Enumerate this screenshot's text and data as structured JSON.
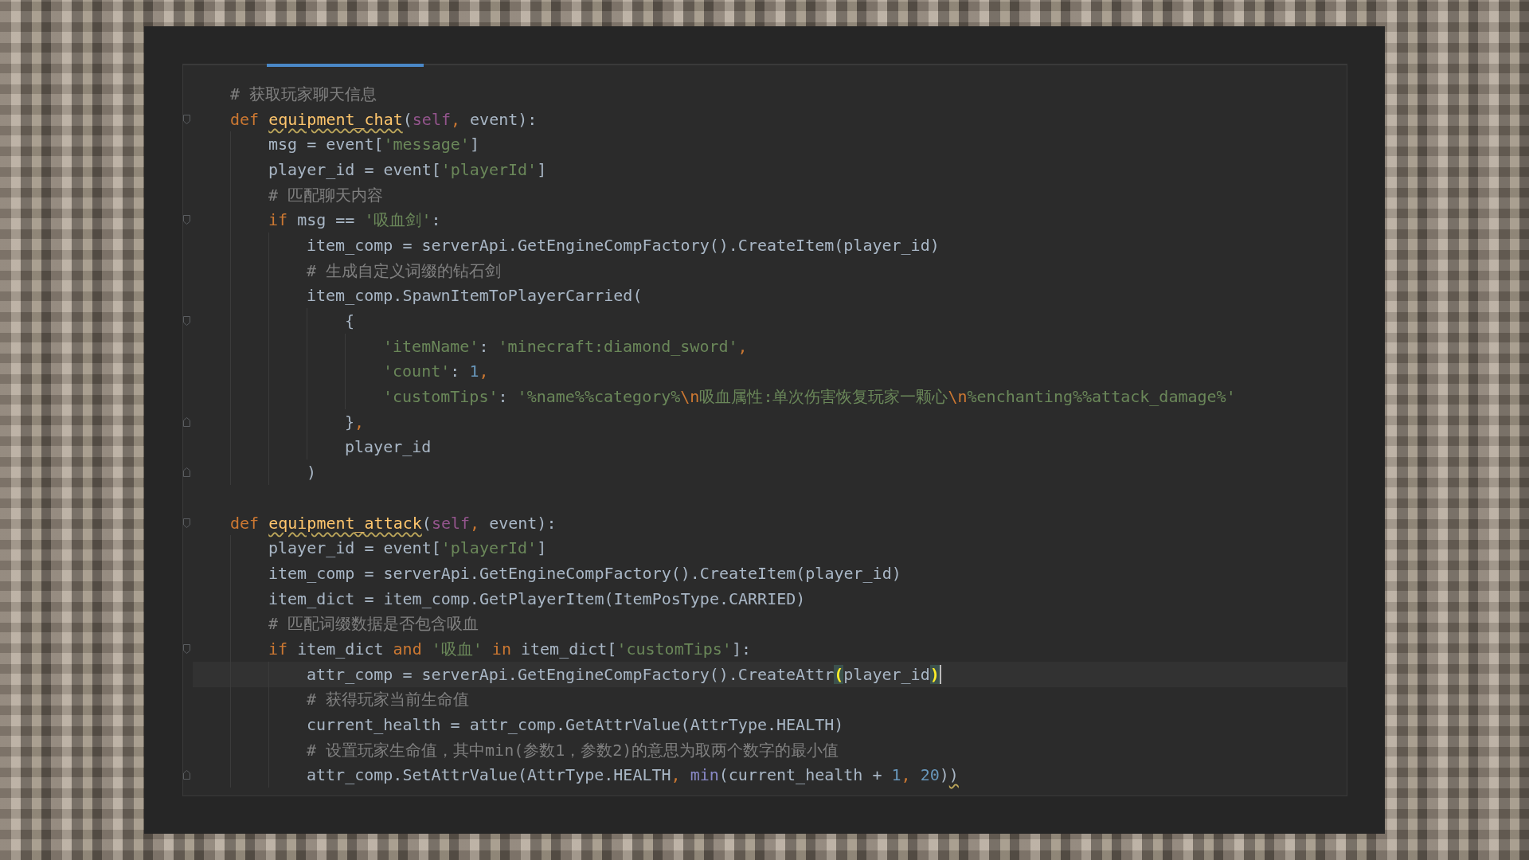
{
  "editor": {
    "lines": [
      {
        "kind": "code",
        "current": false,
        "caret": false,
        "tokens": [
          {
            "text": "# 获取玩家聊天信息",
            "kind": "comment"
          }
        ]
      },
      {
        "kind": "code",
        "fold_start": true,
        "current": false,
        "caret": false,
        "tokens": [
          {
            "text": "def ",
            "kind": "kw"
          },
          {
            "text": "equipment_chat",
            "kind": "fn_warned"
          },
          {
            "text": "(",
            "kind": "plain"
          },
          {
            "text": "self",
            "kind": "self"
          },
          {
            "text": ",",
            "kind": "punct"
          },
          {
            "text": " event):",
            "kind": "plain"
          }
        ],
        "children": [
          {
            "kind": "code",
            "current": false,
            "caret": false,
            "tokens": [
              {
                "text": "msg = event[",
                "kind": "plain"
              },
              {
                "text": "'message'",
                "kind": "str"
              },
              {
                "text": "]",
                "kind": "plain"
              }
            ]
          },
          {
            "kind": "code",
            "current": false,
            "caret": false,
            "tokens": [
              {
                "text": "player_id = event[",
                "kind": "plain"
              },
              {
                "text": "'playerId'",
                "kind": "str"
              },
              {
                "text": "]",
                "kind": "plain"
              }
            ]
          },
          {
            "kind": "code",
            "current": false,
            "caret": false,
            "tokens": [
              {
                "text": "# 匹配聊天内容",
                "kind": "comment"
              }
            ]
          },
          {
            "kind": "code",
            "fold_start": true,
            "current": false,
            "caret": false,
            "tokens": [
              {
                "text": "if",
                "kind": "kw"
              },
              {
                "text": " msg == ",
                "kind": "plain"
              },
              {
                "text": "'吸血剑'",
                "kind": "str"
              },
              {
                "text": ":",
                "kind": "plain"
              }
            ],
            "children": [
              {
                "kind": "code",
                "current": false,
                "caret": false,
                "tokens": [
                  {
                    "text": "item_comp = serverApi.GetEngineCompFactory().CreateItem(player_id)",
                    "kind": "plain"
                  }
                ]
              },
              {
                "kind": "code",
                "current": false,
                "caret": false,
                "tokens": [
                  {
                    "text": "# 生成自定义词缀的钻石剑",
                    "kind": "comment"
                  }
                ]
              },
              {
                "kind": "code",
                "current": false,
                "caret": false,
                "tokens": [
                  {
                    "text": "item_comp.SpawnItemToPlayerCarried(",
                    "kind": "plain"
                  }
                ],
                "children": [
                  {
                    "kind": "code",
                    "fold_start": true,
                    "current": false,
                    "caret": false,
                    "tokens": [
                      {
                        "text": "{",
                        "kind": "plain"
                      }
                    ],
                    "children": [
                      {
                        "kind": "code",
                        "current": false,
                        "caret": false,
                        "tokens": [
                          {
                            "text": "'itemName'",
                            "kind": "str"
                          },
                          {
                            "text": ": ",
                            "kind": "plain"
                          },
                          {
                            "text": "'minecraft:diamond_sword'",
                            "kind": "str"
                          },
                          {
                            "text": ",",
                            "kind": "punct"
                          }
                        ]
                      },
                      {
                        "kind": "code",
                        "current": false,
                        "caret": false,
                        "tokens": [
                          {
                            "text": "'count'",
                            "kind": "str"
                          },
                          {
                            "text": ": ",
                            "kind": "plain"
                          },
                          {
                            "text": "1",
                            "kind": "num"
                          },
                          {
                            "text": ",",
                            "kind": "punct"
                          }
                        ]
                      },
                      {
                        "kind": "code",
                        "current": false,
                        "caret": false,
                        "tokens": [
                          {
                            "text": "'customTips'",
                            "kind": "str"
                          },
                          {
                            "text": ": ",
                            "kind": "plain"
                          },
                          {
                            "text": "'%name%%category%",
                            "kind": "str"
                          },
                          {
                            "text": "\\n",
                            "kind": "esc"
                          },
                          {
                            "text": "吸血属性:单次伤害恢复玩家一颗心",
                            "kind": "str"
                          },
                          {
                            "text": "\\n",
                            "kind": "esc"
                          },
                          {
                            "text": "%enchanting%%attack_damage%'",
                            "kind": "str"
                          }
                        ]
                      }
                    ]
                  },
                  {
                    "kind": "code",
                    "fold_end": true,
                    "current": false,
                    "caret": false,
                    "tokens": [
                      {
                        "text": "}",
                        "kind": "plain"
                      },
                      {
                        "text": ",",
                        "kind": "punct"
                      }
                    ]
                  },
                  {
                    "kind": "code",
                    "current": false,
                    "caret": false,
                    "tokens": [
                      {
                        "text": "player_id",
                        "kind": "plain"
                      }
                    ]
                  }
                ]
              },
              {
                "kind": "code",
                "fold_end": true,
                "current": false,
                "caret": false,
                "tokens": [
                  {
                    "text": ")",
                    "kind": "plain"
                  }
                ]
              }
            ]
          }
        ]
      },
      {
        "kind": "blank"
      },
      {
        "kind": "code",
        "fold_start": true,
        "current": false,
        "caret": false,
        "tokens": [
          {
            "text": "def ",
            "kind": "kw"
          },
          {
            "text": "equipment_attack",
            "kind": "fn_warned"
          },
          {
            "text": "(",
            "kind": "plain"
          },
          {
            "text": "self",
            "kind": "self"
          },
          {
            "text": ",",
            "kind": "punct"
          },
          {
            "text": " event):",
            "kind": "plain"
          }
        ],
        "children": [
          {
            "kind": "code",
            "current": false,
            "caret": false,
            "tokens": [
              {
                "text": "player_id = event[",
                "kind": "plain"
              },
              {
                "text": "'playerId'",
                "kind": "str"
              },
              {
                "text": "]",
                "kind": "plain"
              }
            ]
          },
          {
            "kind": "code",
            "current": false,
            "caret": false,
            "tokens": [
              {
                "text": "item_comp = serverApi.GetEngineCompFactory().CreateItem(player_id)",
                "kind": "plain"
              }
            ]
          },
          {
            "kind": "code",
            "current": false,
            "caret": false,
            "tokens": [
              {
                "text": "item_dict = item_comp.GetPlayerItem(ItemPosType.CARRIED)",
                "kind": "plain"
              }
            ]
          },
          {
            "kind": "code",
            "current": false,
            "caret": false,
            "tokens": [
              {
                "text": "# 匹配词缀数据是否包含吸血",
                "kind": "comment"
              }
            ]
          },
          {
            "kind": "code",
            "fold_start": true,
            "current": false,
            "caret": false,
            "tokens": [
              {
                "text": "if",
                "kind": "kw"
              },
              {
                "text": " item_dict ",
                "kind": "plain"
              },
              {
                "text": "and",
                "kind": "kw"
              },
              {
                "text": " '吸血' ",
                "kind": "str"
              },
              {
                "text": "in",
                "kind": "kw"
              },
              {
                "text": " item_dict[",
                "kind": "plain"
              },
              {
                "text": "'customTips'",
                "kind": "str"
              },
              {
                "text": "]:",
                "kind": "plain"
              }
            ],
            "children": [
              {
                "kind": "code",
                "current": true,
                "caret": true,
                "tokens": [
                  {
                    "text": "attr_comp = serverApi.GetEngineCompFactory().CreateAttr",
                    "kind": "plain"
                  },
                  {
                    "text": "(",
                    "kind": "brace_match"
                  },
                  {
                    "text": "player_id",
                    "kind": "plain"
                  },
                  {
                    "text": ")",
                    "kind": "brace_match"
                  }
                ]
              },
              {
                "kind": "code",
                "current": false,
                "caret": false,
                "tokens": [
                  {
                    "text": "# 获得玩家当前生命值",
                    "kind": "comment"
                  }
                ]
              },
              {
                "kind": "code",
                "current": false,
                "caret": false,
                "tokens": [
                  {
                    "text": "current_health = attr_comp.GetAttrValue(AttrType.HEALTH)",
                    "kind": "plain"
                  }
                ]
              },
              {
                "kind": "code",
                "current": false,
                "caret": false,
                "tokens": [
                  {
                    "text": "# 设置玩家生命值，其中min(参数1，参数2)的意思为取两个数字的最小值",
                    "kind": "comment"
                  }
                ]
              },
              {
                "kind": "code",
                "fold_end": true,
                "current": false,
                "caret": false,
                "tokens": [
                  {
                    "text": "attr_comp.SetAttrValue(AttrType.HEALTH",
                    "kind": "plain"
                  },
                  {
                    "text": ", ",
                    "kind": "punct"
                  },
                  {
                    "text": "min",
                    "kind": "builtin"
                  },
                  {
                    "text": "(current_health + ",
                    "kind": "plain"
                  },
                  {
                    "text": "1",
                    "kind": "num"
                  },
                  {
                    "text": ", ",
                    "kind": "punct"
                  },
                  {
                    "text": "20",
                    "kind": "num"
                  },
                  {
                    "text": ")",
                    "kind": "plain"
                  },
                  {
                    "text": ")",
                    "kind": "plain_warned"
                  }
                ]
              }
            ]
          }
        ]
      }
    ]
  }
}
